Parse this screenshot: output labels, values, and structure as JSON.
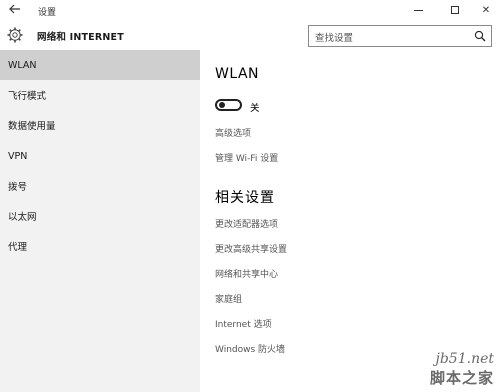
{
  "window": {
    "title": "设置",
    "back_icon": "back-arrow-icon",
    "minimize_icon": "minimize-icon",
    "maximize_icon": "maximize-icon",
    "close_label": "✕"
  },
  "header": {
    "icon": "gear-icon",
    "title": "网络和 INTERNET",
    "search_placeholder": "查找设置",
    "search_icon": "search-icon"
  },
  "sidebar": {
    "items": [
      {
        "label": "WLAN",
        "active": true
      },
      {
        "label": "飞行模式"
      },
      {
        "label": "数据使用量"
      },
      {
        "label": "VPN"
      },
      {
        "label": "拨号"
      },
      {
        "label": "以太网"
      },
      {
        "label": "代理"
      }
    ]
  },
  "main": {
    "wlan_heading": "WLAN",
    "toggle_state": "关",
    "toggle_on": false,
    "links": [
      "高级选项",
      "管理 Wi-Fi 设置"
    ],
    "related_heading": "相关设置",
    "related_links": [
      "更改适配器选项",
      "更改高级共享设置",
      "网络和共享中心",
      "家庭组",
      "Internet 选项",
      "Windows 防火墙"
    ]
  },
  "watermark": {
    "url": "jb51.net",
    "text": "脚本之家"
  }
}
